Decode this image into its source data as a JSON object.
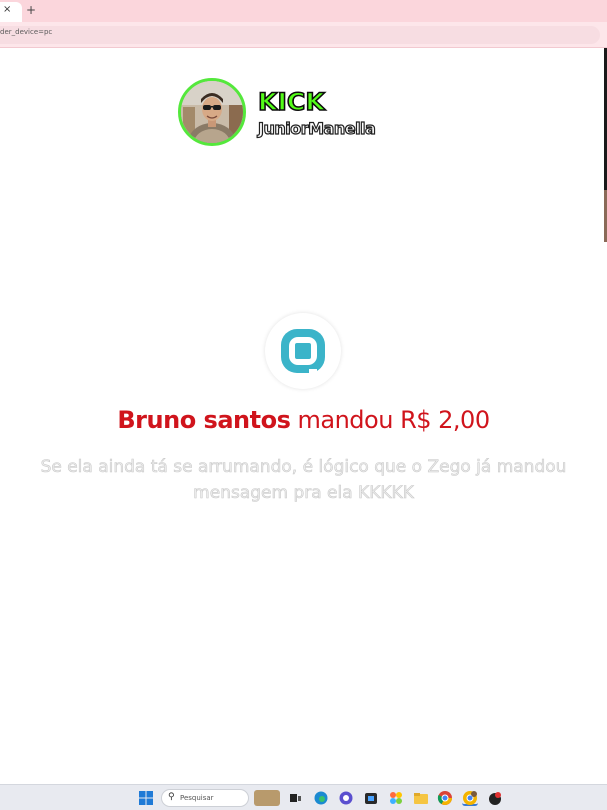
{
  "browser": {
    "tab_close": "×",
    "new_tab": "+",
    "url": "der_device=pc"
  },
  "streamer": {
    "platform": "KICK",
    "username": "JuniorManella",
    "avatar_icon": "streamer-avatar"
  },
  "donation": {
    "logo_icon": "livepix-logo",
    "donor": "Bruno santos",
    "verb": "mandou",
    "amount": "R$ 2,00",
    "message": "Se ela ainda tá se arrumando, é lógico que o Zego já mandou mensagem pra ela KKKKK",
    "color": "#d0141c"
  },
  "taskbar": {
    "search_placeholder": "Pesquisar",
    "items": [
      "windows-start-icon",
      "search-icon",
      "widget-icon",
      "task-view-icon",
      "edge-icon",
      "copilot-icon",
      "store-icon",
      "photos-icon",
      "file-explorer-icon",
      "chrome-icon",
      "chrome-profile-icon",
      "app-icon"
    ]
  }
}
